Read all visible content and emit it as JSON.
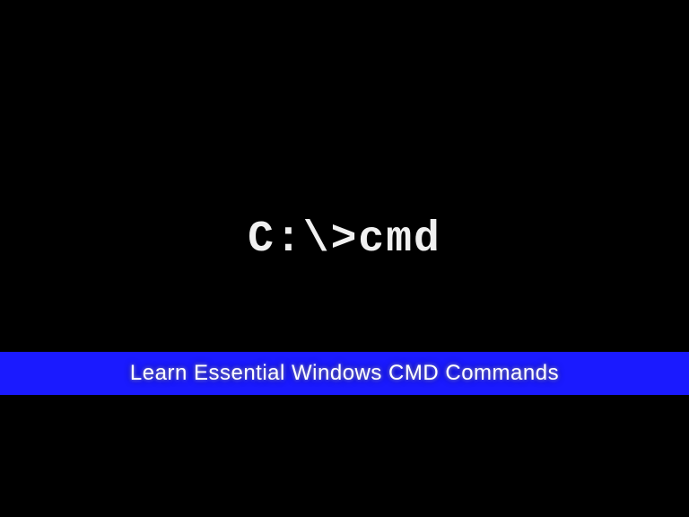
{
  "terminal": {
    "prompt": "C:\\>cmd"
  },
  "banner": {
    "title": "Learn Essential Windows CMD Commands"
  },
  "colors": {
    "background": "#000000",
    "prompt_text": "#f0f0f0",
    "banner_bg": "#1a1aff",
    "banner_text": "#ffffff"
  }
}
